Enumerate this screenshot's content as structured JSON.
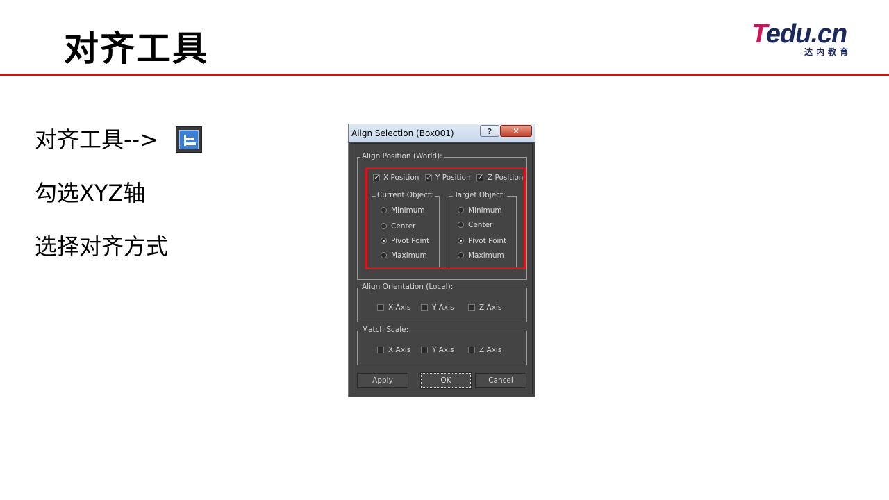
{
  "slide": {
    "title": "对齐工具",
    "bullets": [
      "对齐工具-->",
      "勾选XYZ轴",
      "选择对齐方式"
    ]
  },
  "logo": {
    "letter_t": "T",
    "rest": "edu.cn",
    "subtitle": "达内教育"
  },
  "colors": {
    "rule": "#b01e23",
    "highlight": "#e0101a",
    "dialog_bg": "#444444"
  },
  "toolbar_icon": "align-tool-icon",
  "dialog": {
    "title": "Align Selection (Box001)",
    "help_label": "?",
    "close_label": "✕",
    "align_position": {
      "label": "Align Position (World):",
      "axes": [
        {
          "label": "X Position",
          "checked": true
        },
        {
          "label": "Y Position",
          "checked": true
        },
        {
          "label": "Z Position",
          "checked": true
        }
      ],
      "current_object": {
        "label": "Current Object:",
        "options": [
          "Minimum",
          "Center",
          "Pivot Point",
          "Maximum"
        ],
        "selected": "Pivot Point"
      },
      "target_object": {
        "label": "Target Object:",
        "options": [
          "Minimum",
          "Center",
          "Pivot Point",
          "Maximum"
        ],
        "selected": "Pivot Point"
      }
    },
    "align_orientation": {
      "label": "Align Orientation (Local):",
      "axes": [
        {
          "label": "X Axis",
          "checked": false
        },
        {
          "label": "Y Axis",
          "checked": false
        },
        {
          "label": "Z Axis",
          "checked": false
        }
      ]
    },
    "match_scale": {
      "label": "Match Scale:",
      "axes": [
        {
          "label": "X Axis",
          "checked": false
        },
        {
          "label": "Y Axis",
          "checked": false
        },
        {
          "label": "Z Axis",
          "checked": false
        }
      ]
    },
    "buttons": {
      "apply": "Apply",
      "ok": "OK",
      "cancel": "Cancel"
    }
  }
}
